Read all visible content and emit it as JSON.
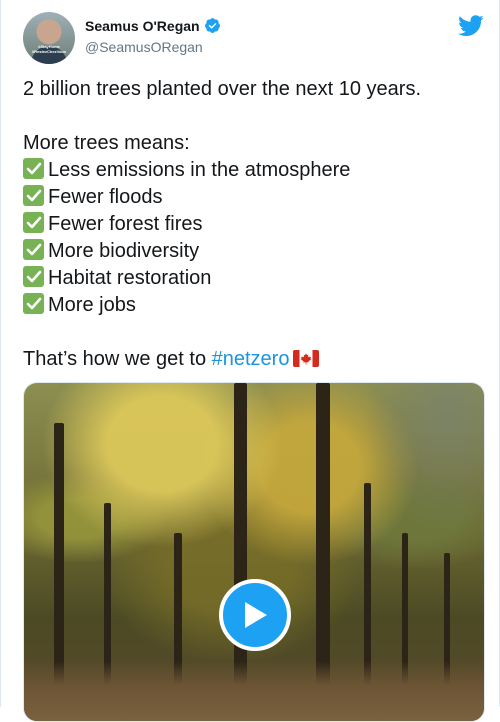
{
  "author": {
    "display_name": "Seamus O'Regan",
    "handle": "@SeamusORegan",
    "verified": true,
    "avatar_icon": "profile-photo",
    "avatar_badge_text": "#StayHome #RestezChezVous"
  },
  "brand": {
    "icon": "twitter-bird-icon",
    "color": "#1da1f2"
  },
  "tweet": {
    "lines": [
      "2 billion trees planted over the next 10 years.",
      "More trees means:"
    ],
    "checklist": [
      "Less emissions in the atmosphere",
      "Fewer floods",
      "Fewer forest fires",
      "More biodiversity",
      "Habitat restoration",
      "More jobs"
    ],
    "closing_text": "That’s how we get to ",
    "hashtag": "#netzero",
    "flag_icon": "canada-flag-icon",
    "hashtag_color": "#1b95e0",
    "check_color": "#77b255"
  },
  "media": {
    "type": "video",
    "description_icon": "play-icon"
  }
}
